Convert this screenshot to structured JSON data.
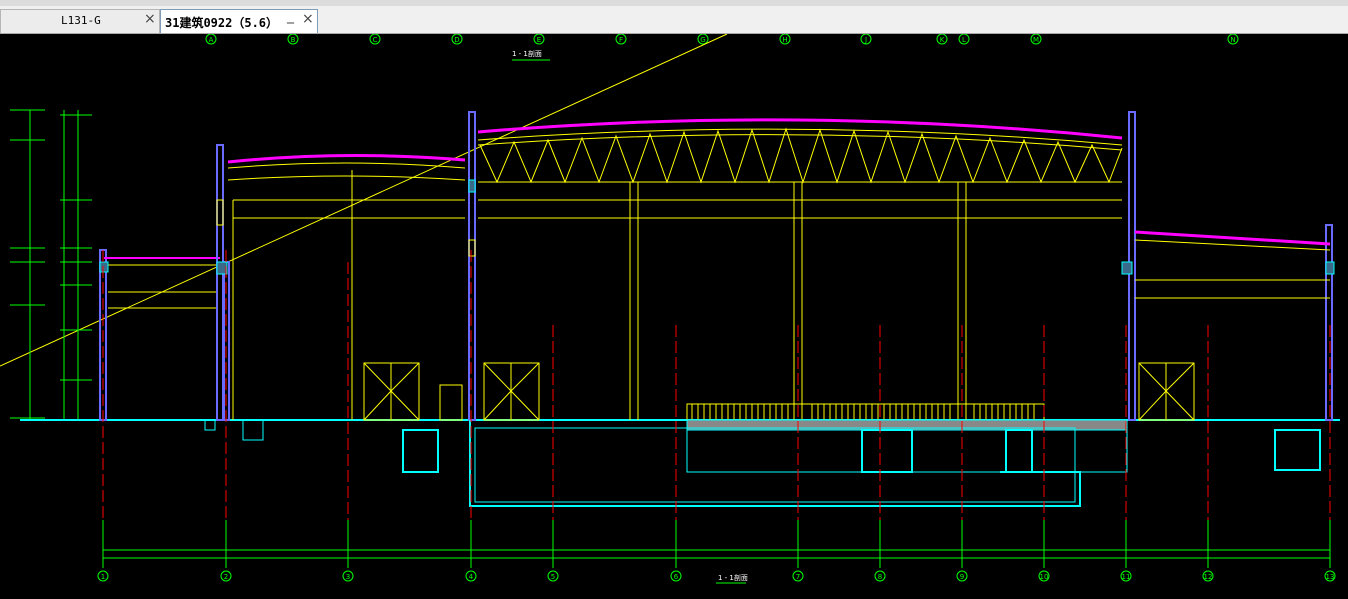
{
  "tabs": [
    {
      "label": "L131-G",
      "close_glyph": "×",
      "active": false
    },
    {
      "label": "31建筑0922（5.6）",
      "close_glyph": "×",
      "minimize_glyph": "_",
      "active": true
    }
  ],
  "drawing": {
    "top_axis_labels": [
      "A",
      "B",
      "C",
      "D",
      "E",
      "F",
      "G",
      "H",
      "J",
      "K",
      "L",
      "M",
      "N"
    ],
    "bottom_axis_labels": [
      "1",
      "2",
      "3",
      "4",
      "5",
      "6",
      "7",
      "8",
      "9",
      "10",
      "11",
      "12",
      "13"
    ],
    "title_top": "1 - 1剖面",
    "title_bottom": "1 - 1剖面",
    "colors": {
      "background": "#000000",
      "line_main": "#ffff00",
      "line_axis": "#00ff00",
      "line_red": "#ff0000",
      "line_cyan": "#00ffff",
      "roof_magenta": "#ff00ff",
      "wall_blue": "#6a6aff"
    }
  }
}
